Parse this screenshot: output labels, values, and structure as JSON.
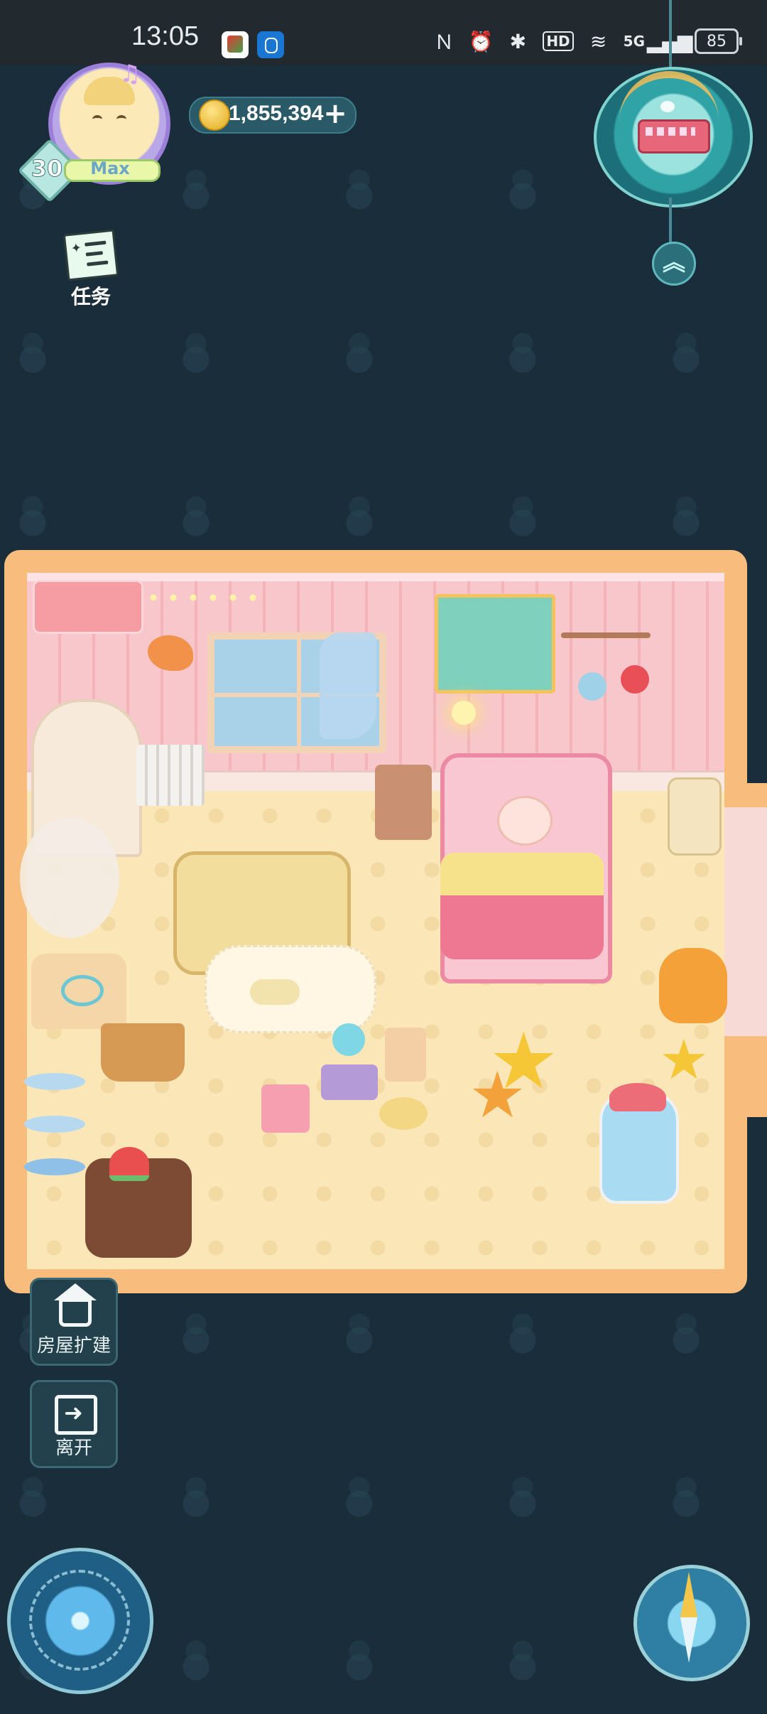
{
  "status_bar": {
    "time": "13:05",
    "battery": "85",
    "network": "5G",
    "hd": "HD",
    "icons": [
      "nfc-icon",
      "alarm-icon",
      "bluetooth-icon",
      "hd-icon",
      "wifi-icon",
      "signal-5g-icon",
      "battery-icon"
    ]
  },
  "player": {
    "level": "30",
    "level_status": "Max",
    "coins": "1,855,394",
    "add_coins_icon": "+"
  },
  "tasks": {
    "label": "任务"
  },
  "map": {
    "expand_icon": "︽"
  },
  "actions": {
    "expand_house": "房屋扩建",
    "leave": "离开"
  },
  "colors": {
    "background": "#1a2d3b",
    "room_frame": "#f8bd7d",
    "wall": "#f7c7cb",
    "floor": "#fbe6b8",
    "button_bg": "#22414c"
  }
}
